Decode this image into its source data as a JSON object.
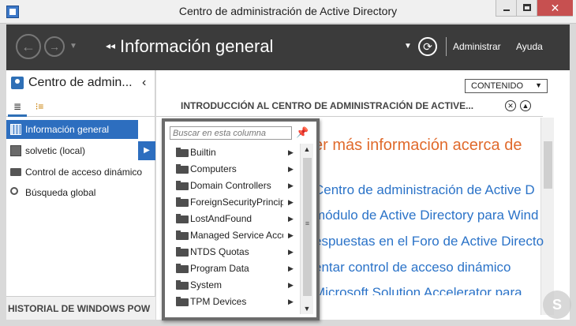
{
  "window": {
    "title": "Centro de administración de Active Directory",
    "minimize_glyph": "",
    "maximize_glyph": "",
    "close_glyph": "✕"
  },
  "navbar": {
    "breadcrumb_arrows": "◂◂",
    "title": "Información general",
    "manage": "Administrar",
    "help": "Ayuda"
  },
  "left_pane": {
    "title": "Centro de admin...",
    "collapse": "‹",
    "tabs": [
      "≣",
      "⁝≡"
    ],
    "items": [
      {
        "label": "Información general",
        "icon": "grid-icon",
        "selected": true
      },
      {
        "label": "solvetic (local)",
        "icon": "server-icon",
        "selected": false
      },
      {
        "label": "Control de acceso dinámico",
        "icon": "folder-icon",
        "selected": false
      },
      {
        "label": "Búsqueda global",
        "icon": "search-icon",
        "selected": false
      }
    ],
    "history": "HISTORIAL DE WINDOWS POW"
  },
  "right_pane": {
    "content_dropdown": "CONTENIDO",
    "intro_heading": "INTRODUCCIÓN AL CENTRO DE ADMINISTRACIÓN DE ACTIVE...",
    "learn_more": "er más información acerca de",
    "links": [
      "Centro de administración de Active D",
      "módulo de Active Directory para Wind",
      "espuestas en el Foro de Active Directo",
      "entar control de acceso dinámico",
      "Microsoft Solution Accelerator para"
    ]
  },
  "popup": {
    "search_placeholder": "Buscar en esta columna",
    "items": [
      "Builtin",
      "Computers",
      "Domain Controllers",
      "ForeignSecurityPrincipals",
      "LostAndFound",
      "Managed Service Accounts",
      "NTDS Quotas",
      "Program Data",
      "System",
      "TPM Devices"
    ]
  },
  "colors": {
    "accent": "#2d6ebf",
    "nav_bg": "#3b3b3b",
    "link": "#2b73c8",
    "orange": "#e06a2c"
  }
}
